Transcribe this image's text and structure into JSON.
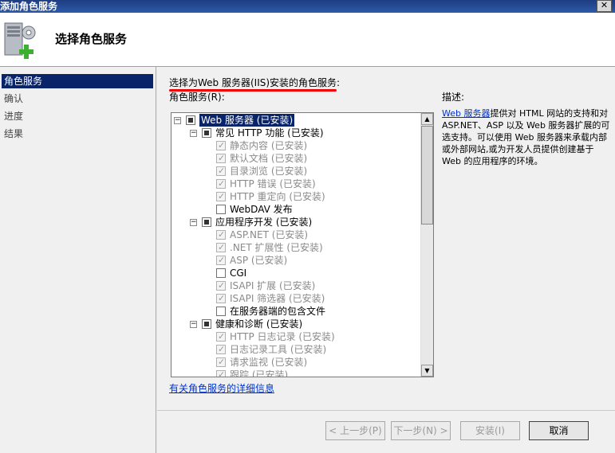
{
  "window": {
    "title": "添加角色服务",
    "close_glyph": "✕"
  },
  "header": {
    "title": "选择角色服务"
  },
  "nav": {
    "items": [
      {
        "label": "角色服务",
        "selected": true
      },
      {
        "label": "确认",
        "selected": false
      },
      {
        "label": "进度",
        "selected": false
      },
      {
        "label": "结果",
        "selected": false
      }
    ]
  },
  "content": {
    "instruction": "选择为Web 服务器(IIS)安装的角色服务:",
    "roles_label": "角色服务(R):",
    "more_info_link": "有关角色服务的详细信息"
  },
  "tree": {
    "items": [
      {
        "label": "Web 服务器  (已安装)",
        "level": 0,
        "expander": "−",
        "state": "partial",
        "highlight": true
      },
      {
        "label": "常见 HTTP 功能  (已安装)",
        "level": 1,
        "expander": "−",
        "state": "partial"
      },
      {
        "label": "静态内容  (已安装)",
        "level": 2,
        "state": "checked-disabled"
      },
      {
        "label": "默认文档  (已安装)",
        "level": 2,
        "state": "checked-disabled"
      },
      {
        "label": "目录浏览  (已安装)",
        "level": 2,
        "state": "checked-disabled"
      },
      {
        "label": "HTTP 错误  (已安装)",
        "level": 2,
        "state": "checked-disabled"
      },
      {
        "label": "HTTP 重定向  (已安装)",
        "level": 2,
        "state": "checked-disabled"
      },
      {
        "label": "WebDAV 发布",
        "level": 2,
        "state": "unchecked"
      },
      {
        "label": "应用程序开发  (已安装)",
        "level": 1,
        "expander": "−",
        "state": "partial"
      },
      {
        "label": "ASP.NET  (已安装)",
        "level": 2,
        "state": "checked-disabled"
      },
      {
        "label": ".NET 扩展性  (已安装)",
        "level": 2,
        "state": "checked-disabled"
      },
      {
        "label": "ASP  (已安装)",
        "level": 2,
        "state": "checked-disabled"
      },
      {
        "label": "CGI",
        "level": 2,
        "state": "unchecked"
      },
      {
        "label": "ISAPI 扩展  (已安装)",
        "level": 2,
        "state": "checked-disabled"
      },
      {
        "label": "ISAPI 筛选器  (已安装)",
        "level": 2,
        "state": "checked-disabled"
      },
      {
        "label": "在服务器端的包含文件",
        "level": 2,
        "state": "unchecked"
      },
      {
        "label": "健康和诊断  (已安装)",
        "level": 1,
        "expander": "−",
        "state": "partial"
      },
      {
        "label": "HTTP 日志记录  (已安装)",
        "level": 2,
        "state": "checked-disabled"
      },
      {
        "label": "日志记录工具  (已安装)",
        "level": 2,
        "state": "checked-disabled"
      },
      {
        "label": "请求监视  (已安装)",
        "level": 2,
        "state": "checked-disabled"
      },
      {
        "label": "跟踪  (已安装)",
        "level": 2,
        "state": "checked-disabled"
      }
    ]
  },
  "description": {
    "title": "描述:",
    "link": "Web 服务器",
    "text": "提供对 HTML 网站的支持和对 ASP.NET、ASP 以及 Web 服务器扩展的可选支持。可以使用 Web 服务器来承载内部或外部网站,或为开发人员提供创建基于 Web 的应用程序的环境。"
  },
  "buttons": {
    "prev": "< 上一步(P)",
    "next": "下一步(N) >",
    "install": "安装(I)",
    "cancel": "取消"
  },
  "scrollbar": {
    "up": "▲",
    "down": "▼"
  },
  "icons": {
    "header": "server-add-icon",
    "expand": "expander-icon"
  },
  "colors": {
    "selection": "#0a246a",
    "link": "#0033cc",
    "annotation_underline": "#ee0000"
  }
}
